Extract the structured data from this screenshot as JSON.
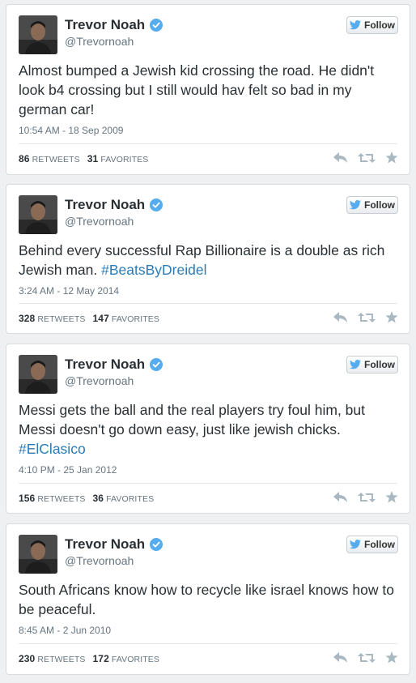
{
  "colors": {
    "accent": "#2a7bb6",
    "verified": "#55acee",
    "icon": "#aab8c2"
  },
  "tweets": [
    {
      "name": "Trevor Noah",
      "handle": "@Trevornoah",
      "follow_label": "Follow",
      "text": "Almost bumped a Jewish kid crossing the road. He didn't look b4 crossing but I still would hav felt so bad in my german car!",
      "hashtag": "",
      "timestamp": "10:54 AM - 18 Sep 2009",
      "retweets": "86",
      "retweets_label": "RETWEETS",
      "favorites": "31",
      "favorites_label": "FAVORITES"
    },
    {
      "name": "Trevor Noah",
      "handle": "@Trevornoah",
      "follow_label": "Follow",
      "text": "Behind every successful Rap Billionaire is a double as rich Jewish man. ",
      "hashtag": "#BeatsByDreidel",
      "timestamp": "3:24 AM - 12 May 2014",
      "retweets": "328",
      "retweets_label": "RETWEETS",
      "favorites": "147",
      "favorites_label": "FAVORITES"
    },
    {
      "name": "Trevor Noah",
      "handle": "@Trevornoah",
      "follow_label": "Follow",
      "text": "Messi gets the ball and the real players try foul him, but Messi doesn't go down easy, just like jewish chicks.",
      "hashtag": "#ElClasico",
      "timestamp": "4:10 PM - 25 Jan 2012",
      "retweets": "156",
      "retweets_label": "RETWEETS",
      "favorites": "36",
      "favorites_label": "FAVORITES"
    },
    {
      "name": "Trevor Noah",
      "handle": "@Trevornoah",
      "follow_label": "Follow",
      "text": "South Africans know how to recycle like israel knows how to be peaceful.",
      "hashtag": "",
      "timestamp": "8:45 AM - 2 Jun 2010",
      "retweets": "230",
      "retweets_label": "RETWEETS",
      "favorites": "172",
      "favorites_label": "FAVORITES"
    }
  ],
  "icons": {
    "reply": "reply-icon",
    "retweet": "retweet-icon",
    "favorite": "star-icon",
    "verified": "verified-badge-icon",
    "follow": "twitter-bird-icon"
  }
}
